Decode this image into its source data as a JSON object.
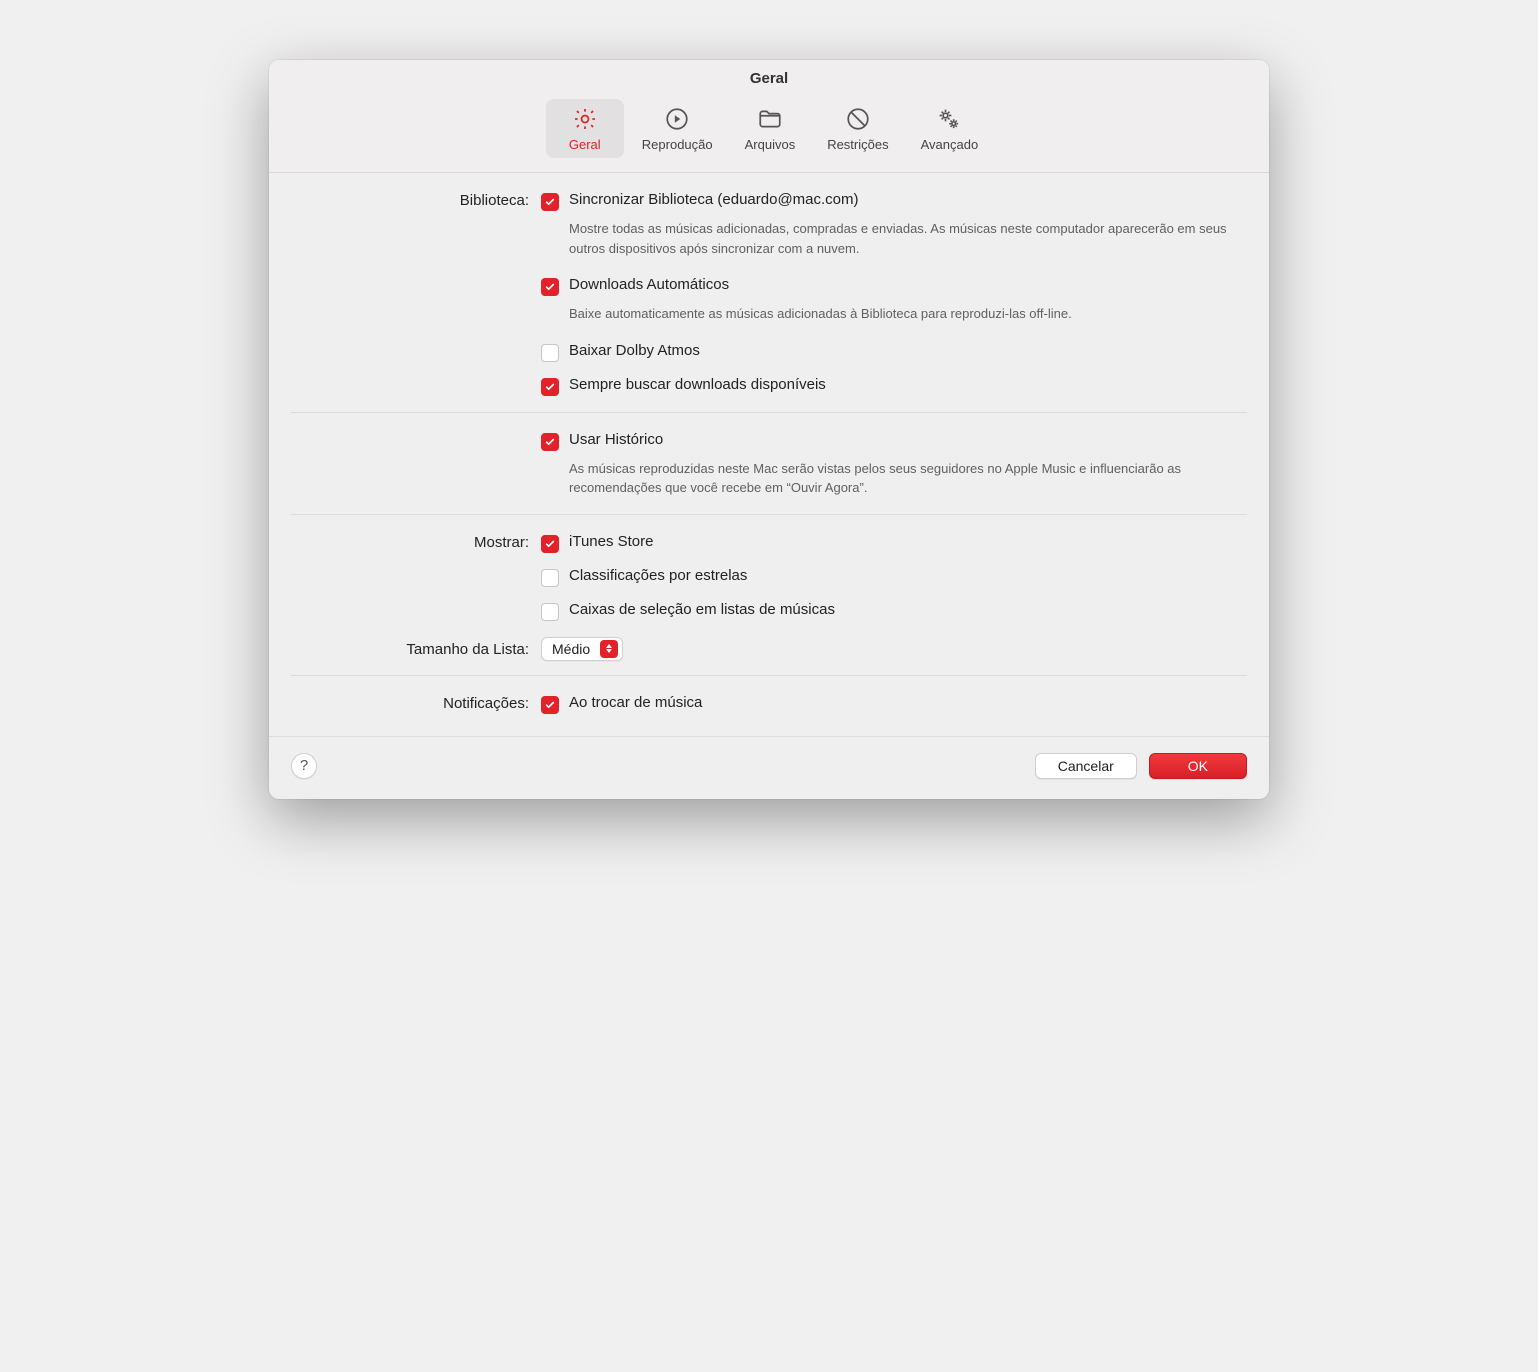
{
  "window": {
    "title": "Geral"
  },
  "tabs": {
    "geral": "Geral",
    "reproducao": "Reprodução",
    "arquivos": "Arquivos",
    "restricoes": "Restrições",
    "avancado": "Avançado"
  },
  "sections": {
    "biblioteca": {
      "label": "Biblioteca:",
      "items": {
        "sync": {
          "label": "Sincronizar Biblioteca (eduardo@mac.com)",
          "help": "Mostre todas as músicas adicionadas, compradas e enviadas. As músicas neste computador aparecerão em seus outros dispositivos após sincronizar com a nuvem."
        },
        "autodl": {
          "label": "Downloads Automáticos",
          "help": "Baixe automaticamente as músicas adicionadas à Biblioteca para reproduzi-las off-line."
        },
        "dolby": {
          "label": "Baixar Dolby Atmos"
        },
        "fetch": {
          "label": "Sempre buscar downloads disponíveis"
        }
      }
    },
    "historico": {
      "items": {
        "usar": {
          "label": "Usar Histórico",
          "help": "As músicas reproduzidas neste Mac serão vistas pelos seus seguidores no Apple Music e influenciarão as recomendações que você recebe em “Ouvir Agora”."
        }
      }
    },
    "mostrar": {
      "label": "Mostrar:",
      "items": {
        "itunes": {
          "label": "iTunes Store"
        },
        "stars": {
          "label": "Classificações por estrelas"
        },
        "checklists": {
          "label": "Caixas de seleção em listas de músicas"
        }
      }
    },
    "tamanho": {
      "label": "Tamanho da Lista:",
      "value": "Médio"
    },
    "notificacoes": {
      "label": "Notificações:",
      "items": {
        "trocar": {
          "label": "Ao trocar de música"
        }
      }
    }
  },
  "footer": {
    "help": "?",
    "cancel": "Cancelar",
    "ok": "OK"
  }
}
